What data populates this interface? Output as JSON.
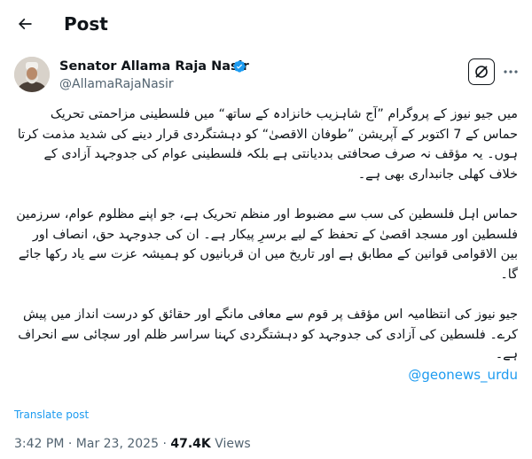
{
  "header": {
    "back_icon": "arrow-left-icon",
    "title": "Post"
  },
  "author": {
    "name": "Senator Allama Raja Nasir",
    "handle": "@AllamaRajaNasir",
    "verified": true,
    "verified_color": "#1d9bf0"
  },
  "actions": {
    "grok_icon": "grok-icon",
    "more_icon": "more-dots-icon"
  },
  "tweet": {
    "paragraphs": [
      "میں جیو نیوز کے پروگرام ”آج شاہزیب خانزادہ کے ساتھ“ میں فلسطینی مزاحمتی تحریک حماس کے 7 اکتوبر کے آپریشن ”طوفان الاقصیٰ“ کو دہشتگردی قرار دینے کی شدید مذمت کرتا ہوں۔ یہ مؤقف نہ صرف صحافتی بددیانتی ہے بلکہ فلسطینی عوام کی جدوجہد آزادی کے خلاف کھلی جانبداری بھی ہے۔",
      "حماس اہل فلسطین کی سب سے مضبوط اور منظم تحریک ہے، جو اپنے مظلوم عوام، سرزمین فلسطین اور مسجد اقصیٰ کے تحفظ کے لیے برسرِ پیکار ہے۔ ان کی جدوجہد حق، انصاف اور بین الاقوامی قوانین کے مطابق ہے اور تاریخ میں ان قربانیوں کو ہمیشہ عزت سے یاد رکھا جائے گا۔",
      "جیو نیوز کی انتظامیہ اس مؤقف پر قوم سے معافی مانگے اور حقائق کو درست انداز میں پیش کرے۔ فلسطین کی آزادی کی جدوجہد کو دہشتگردی کہنا سراسر ظلم اور سچائی سے انحراف ہے۔"
    ],
    "mention": "@geonews_urdu",
    "link_color": "#1d9bf0"
  },
  "translate_label": "Translate post",
  "meta": {
    "time": "3:42 PM",
    "separator": "·",
    "date": "Mar 23, 2025",
    "views_count": "47.4K",
    "views_label": "Views"
  }
}
